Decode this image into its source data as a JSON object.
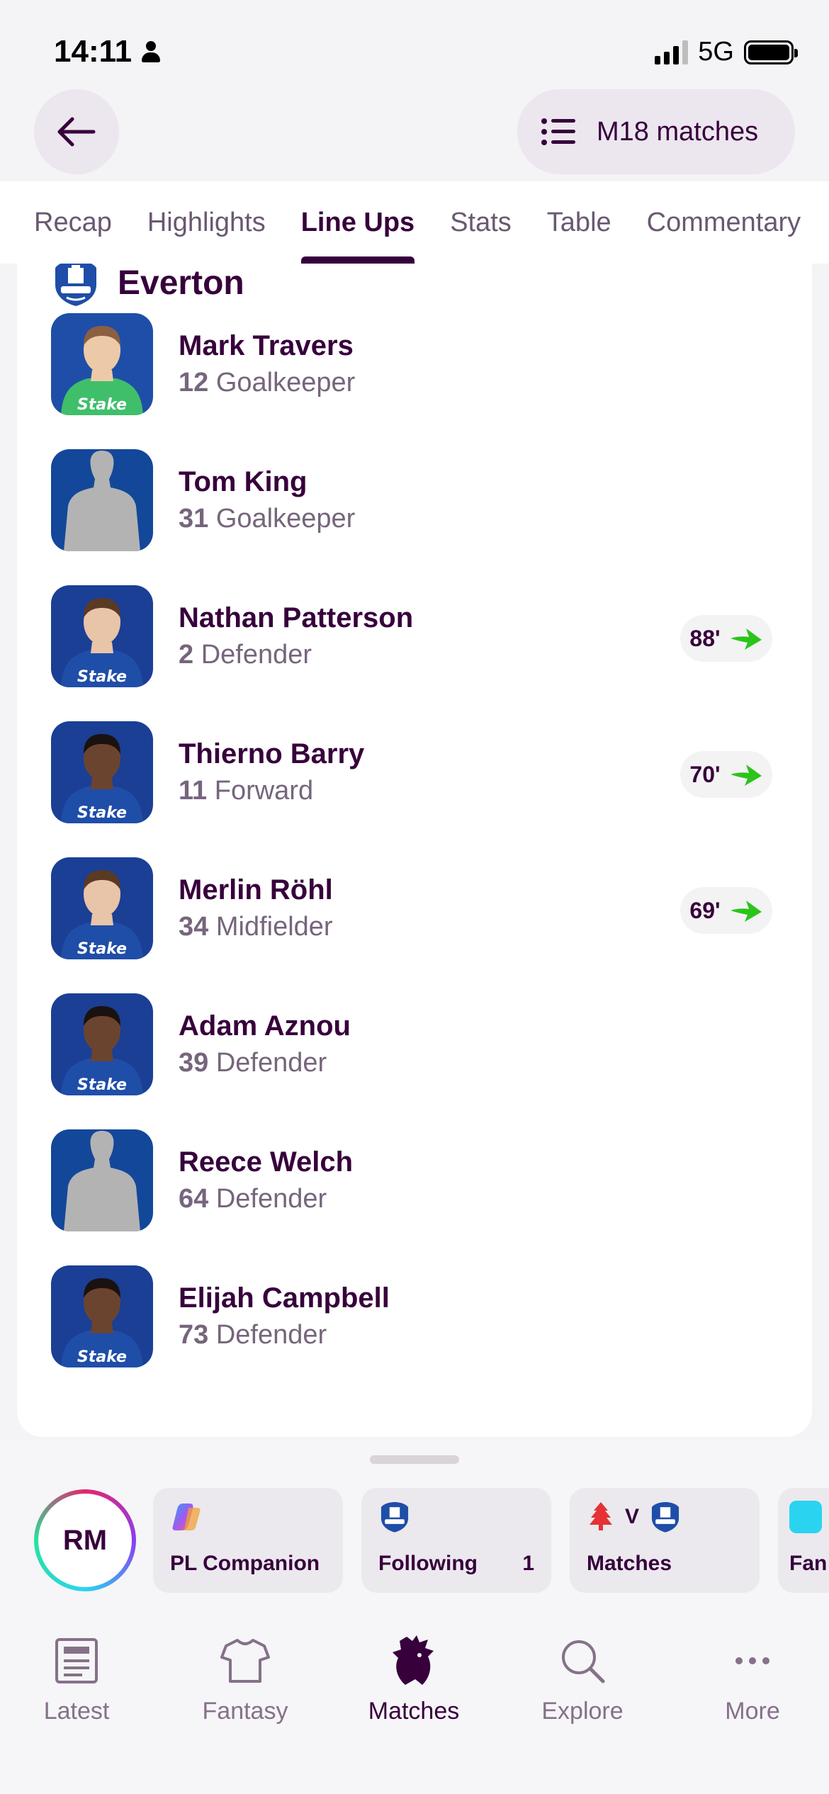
{
  "status": {
    "time": "14:11",
    "network": "5G"
  },
  "header": {
    "matches_button_label": "M18 matches"
  },
  "tabs": [
    {
      "label": "Recap",
      "active": false
    },
    {
      "label": "Highlights",
      "active": false
    },
    {
      "label": "Line Ups",
      "active": true
    },
    {
      "label": "Stats",
      "active": false
    },
    {
      "label": "Table",
      "active": false
    },
    {
      "label": "Commentary",
      "active": false
    }
  ],
  "team": {
    "name": "Everton"
  },
  "players": [
    {
      "name": "Mark Travers",
      "number": "12",
      "position": "Goalkeeper",
      "photo": "keeper",
      "sub": ""
    },
    {
      "name": "Tom King",
      "number": "31",
      "position": "Goalkeeper",
      "photo": "placeholder",
      "sub": ""
    },
    {
      "name": "Nathan Patterson",
      "number": "2",
      "position": "Defender",
      "photo": "kit",
      "sub": "88'"
    },
    {
      "name": "Thierno Barry",
      "number": "11",
      "position": "Forward",
      "photo": "kit-dark",
      "sub": "70'"
    },
    {
      "name": "Merlin Röhl",
      "number": "34",
      "position": "Midfielder",
      "photo": "kit",
      "sub": "69'"
    },
    {
      "name": "Adam Aznou",
      "number": "39",
      "position": "Defender",
      "photo": "kit-dark",
      "sub": ""
    },
    {
      "name": "Reece Welch",
      "number": "64",
      "position": "Defender",
      "photo": "placeholder",
      "sub": ""
    },
    {
      "name": "Elijah Campbell",
      "number": "73",
      "position": "Defender",
      "photo": "kit-dark",
      "sub": ""
    }
  ],
  "drawer": {
    "avatar_initials": "RM",
    "chips": [
      {
        "label": "PL Companion",
        "count": ""
      },
      {
        "label": "Following",
        "count": "1"
      },
      {
        "label": "Matches",
        "count": "",
        "versus": "V"
      },
      {
        "label": "Fan",
        "count": ""
      }
    ]
  },
  "nav": [
    {
      "label": "Latest",
      "icon": "news-icon",
      "active": false
    },
    {
      "label": "Fantasy",
      "icon": "shirt-icon",
      "active": false
    },
    {
      "label": "Matches",
      "icon": "lion-icon",
      "active": true
    },
    {
      "label": "Explore",
      "icon": "search-icon",
      "active": false
    },
    {
      "label": "More",
      "icon": "more-icon",
      "active": false
    }
  ],
  "colors": {
    "primary": "#37003c",
    "sub_arrow": "#2bc41b",
    "everton_blue": "#1f4ea8"
  }
}
